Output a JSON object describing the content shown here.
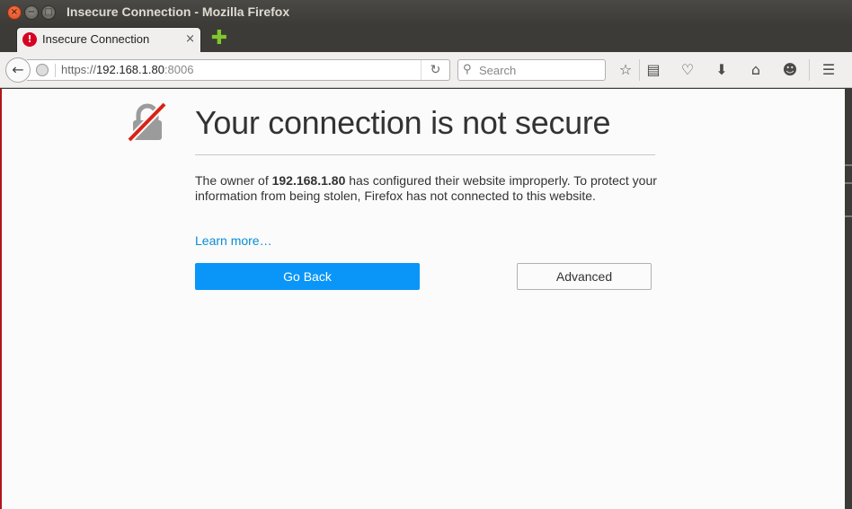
{
  "window": {
    "title": "Insecure Connection - Mozilla Firefox",
    "close_glyph": "×",
    "minimize_glyph": "−",
    "maximize_glyph": "□"
  },
  "tabs": [
    {
      "label": "Insecure Connection",
      "icon": "warning-icon",
      "icon_glyph": "!",
      "close_glyph": "×"
    }
  ],
  "newtab": {
    "glyph": "✚",
    "icon": "plus-icon"
  },
  "navbar": {
    "back_glyph": "←",
    "url_scheme": "https://",
    "url_host": "192.168.1.80",
    "url_port": ":8006",
    "reload_glyph": "↻",
    "search_placeholder": "Search",
    "search_glyph": "⚲",
    "toolbar_icons": [
      {
        "name": "bookmark-star-icon",
        "glyph": "☆"
      },
      {
        "name": "reading-list-icon",
        "glyph": "▤"
      },
      {
        "name": "pocket-icon",
        "glyph": "♡"
      },
      {
        "name": "download-icon",
        "glyph": "⬇"
      },
      {
        "name": "home-icon",
        "glyph": "⌂"
      },
      {
        "name": "hello-icon",
        "glyph": "☻"
      },
      {
        "name": "menu-icon",
        "glyph": "☰"
      }
    ]
  },
  "page": {
    "headline": "Your connection is not secure",
    "desc_pre": "The owner of ",
    "desc_host": "192.168.1.80",
    "desc_post": " has configured their website improperly. To protect your information from being stolen, Firefox has not connected to this website.",
    "learn_more": "Learn more…",
    "go_back": "Go Back",
    "advanced": "Advanced"
  },
  "colors": {
    "accent_button": "#0996f8",
    "link": "#0a8dd5",
    "error_red": "#d70022",
    "left_border": "#b2151d"
  }
}
